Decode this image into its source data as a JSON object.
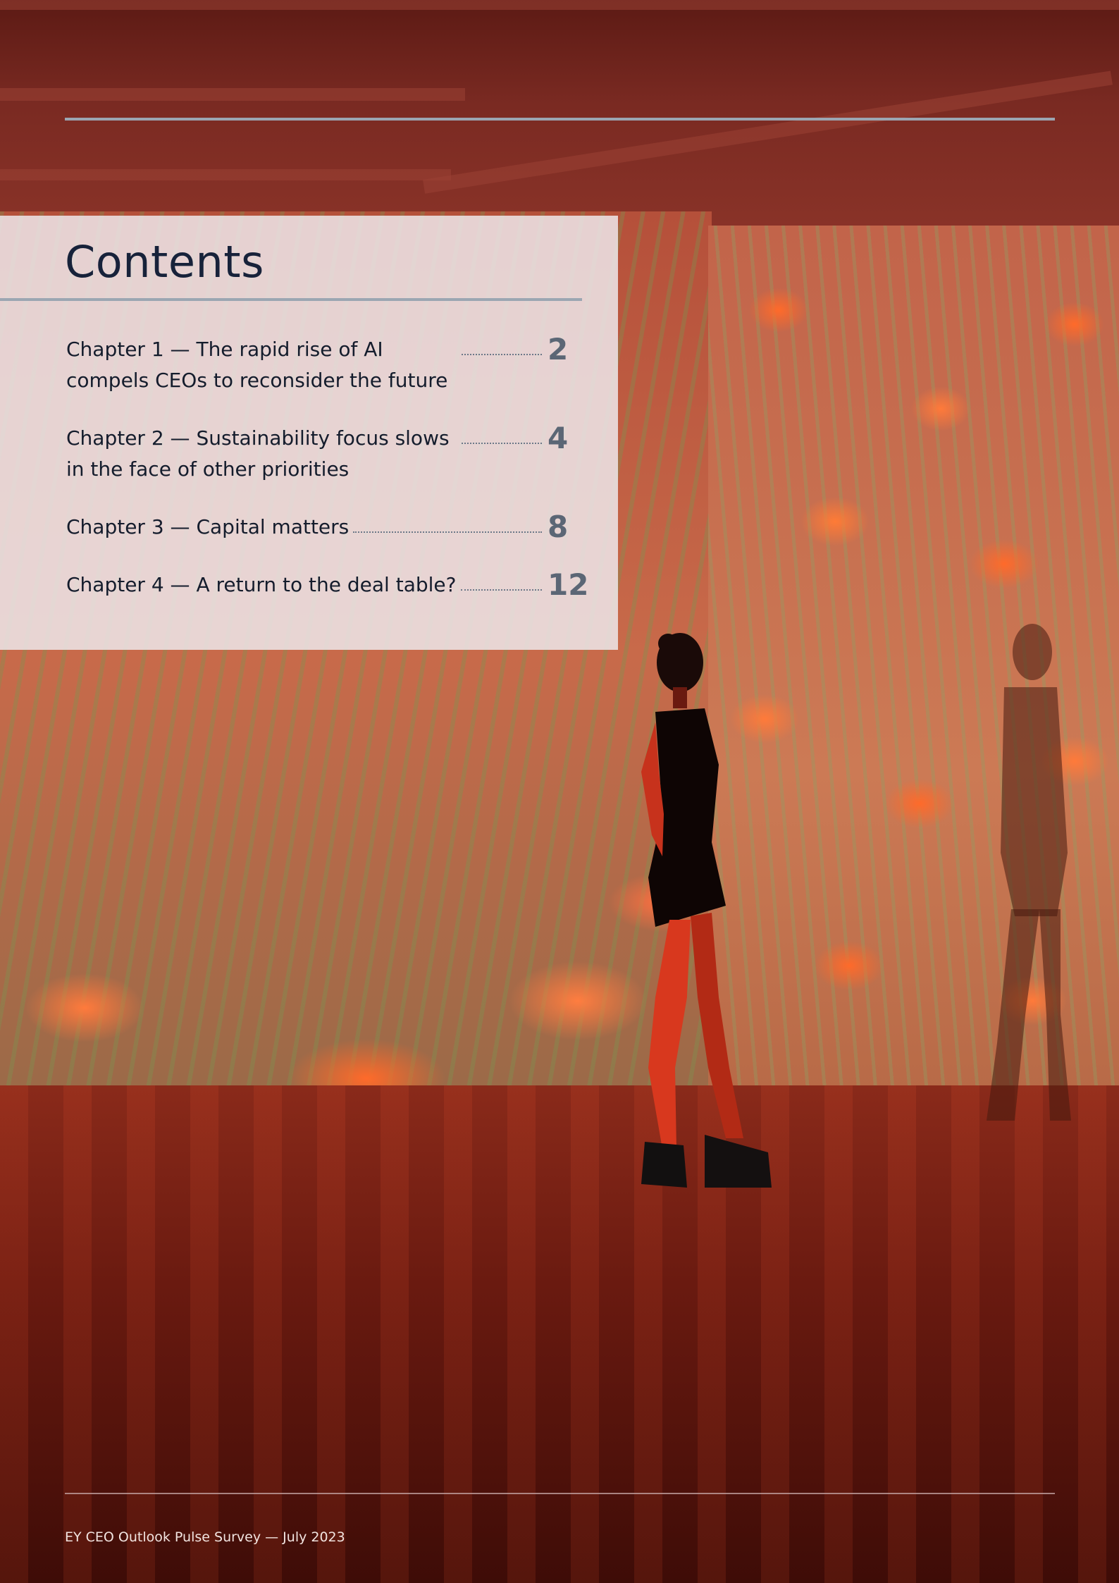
{
  "contents": {
    "title": "Contents",
    "entries": [
      {
        "text": "Chapter 1 — The rapid rise of AI compels CEOs to reconsider the future",
        "page": "2"
      },
      {
        "text": "Chapter 2 — Sustainability focus slows in the face of other priorities",
        "page": "4"
      },
      {
        "text": "Chapter 3 — Capital matters",
        "page": "8"
      },
      {
        "text": "Chapter 4 — A return to the deal table?",
        "page": "12"
      }
    ]
  },
  "footer": {
    "text": "EY CEO Outlook Pulse Survey — July 2023"
  },
  "colors": {
    "title": "#17223a",
    "page_number": "#5b6675",
    "rule": "#9ba6b2",
    "panel": "#eee6ea"
  }
}
